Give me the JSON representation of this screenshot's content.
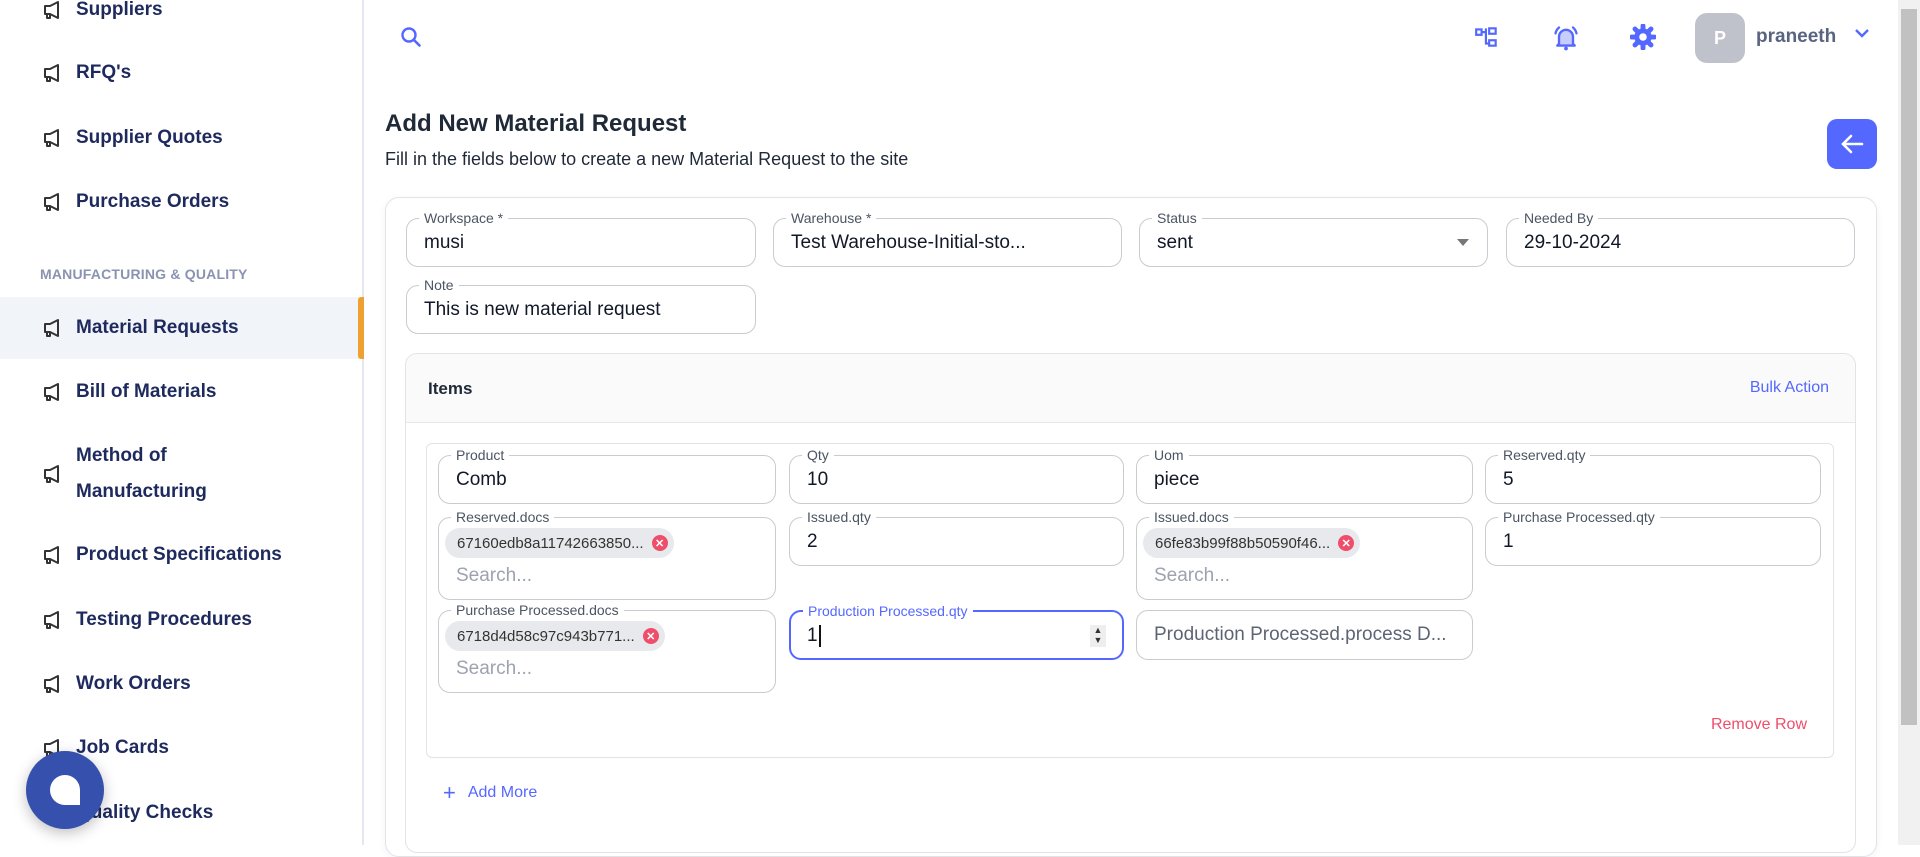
{
  "sidebar": {
    "items": [
      {
        "label": "Suppliers"
      },
      {
        "label": "RFQ's"
      },
      {
        "label": "Supplier Quotes"
      },
      {
        "label": "Purchase Orders"
      }
    ],
    "section_header": "MANUFACTURING & QUALITY",
    "mfg_items": [
      {
        "label": "Material Requests",
        "active": true
      },
      {
        "label": "Bill of Materials"
      },
      {
        "label": "Method of Manufacturing"
      },
      {
        "label": "Product Specifications"
      },
      {
        "label": "Testing Procedures"
      },
      {
        "label": "Work Orders"
      },
      {
        "label": "Job Cards"
      },
      {
        "label": "Quality Checks"
      }
    ]
  },
  "topbar": {
    "avatar_initial": "P",
    "username": "praneeth",
    "icons": [
      "search-icon",
      "hierarchy-icon",
      "bell-icon",
      "gear-icon",
      "chevron-down-icon"
    ]
  },
  "page": {
    "title": "Add New Material Request",
    "subtitle": "Fill in the fields below to create a new Material Request to the site"
  },
  "form": {
    "workspace": {
      "label": "Workspace *",
      "value": "musi"
    },
    "warehouse": {
      "label": "Warehouse *",
      "value": "Test Warehouse-Initial-sto..."
    },
    "status": {
      "label": "Status",
      "value": "sent"
    },
    "needed_by": {
      "label": "Needed By",
      "value": "29-10-2024"
    },
    "note": {
      "label": "Note",
      "value": "This is new material request"
    }
  },
  "items": {
    "title": "Items",
    "bulk_action": "Bulk Action",
    "remove_row": "Remove Row",
    "add_more": "Add More",
    "row": {
      "product": {
        "label": "Product",
        "value": "Comb"
      },
      "qty": {
        "label": "Qty",
        "value": "10"
      },
      "uom": {
        "label": "Uom",
        "value": "piece"
      },
      "reserved_qty": {
        "label": "Reserved.qty",
        "value": "5"
      },
      "reserved_docs": {
        "label": "Reserved.docs",
        "chip": "67160edb8a11742663850...",
        "placeholder": "Search..."
      },
      "issued_qty": {
        "label": "Issued.qty",
        "value": "2"
      },
      "issued_docs": {
        "label": "Issued.docs",
        "chip": "66fe83b99f88b50590f46...",
        "placeholder": "Search..."
      },
      "purchase_processed_qty": {
        "label": "Purchase Processed.qty",
        "value": "1"
      },
      "purchase_processed_docs": {
        "label": "Purchase Processed.docs",
        "chip": "6718d4d58c97c943b771...",
        "placeholder": "Search..."
      },
      "production_processed_qty": {
        "label": "Production Processed.qty",
        "value": "1"
      },
      "production_processed_process": {
        "placeholder": "Production Processed.process D..."
      }
    }
  },
  "colors": {
    "accent": "#5468ff",
    "navy": "#1e2a5e",
    "danger": "#ef4e6b",
    "active_bar": "#f0a030"
  }
}
